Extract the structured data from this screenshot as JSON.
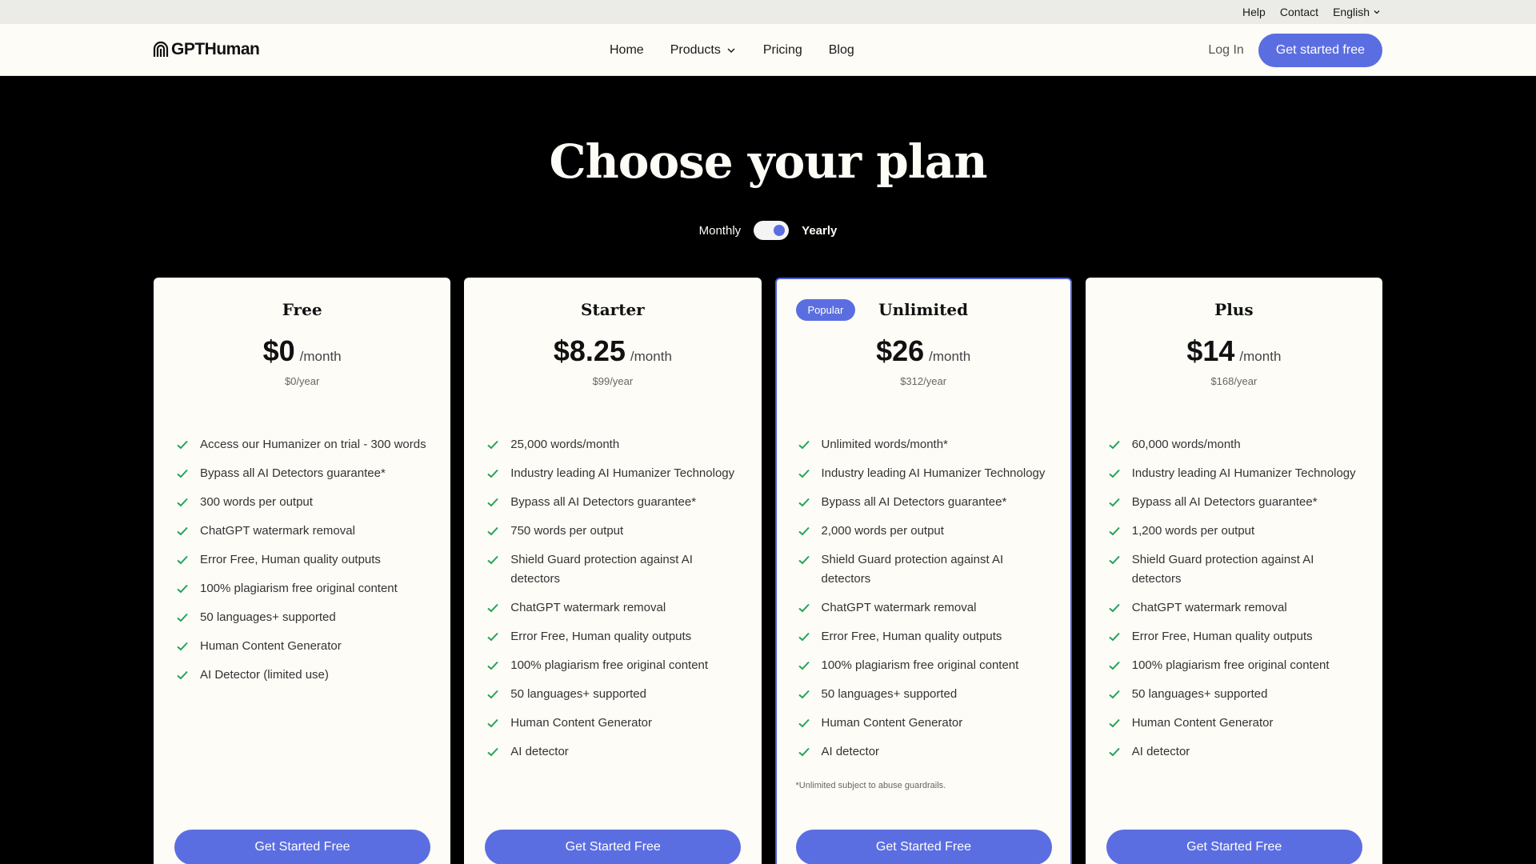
{
  "util_nav": {
    "help": "Help",
    "contact": "Contact",
    "language": "English"
  },
  "brand": {
    "name": "GPTHuman"
  },
  "nav": {
    "home": "Home",
    "products": "Products",
    "pricing": "Pricing",
    "blog": "Blog",
    "login": "Log In",
    "cta": "Get started free"
  },
  "hero": {
    "title": "Choose your plan",
    "toggle_monthly": "Monthly",
    "toggle_yearly": "Yearly",
    "toggle_state": "yearly"
  },
  "colors": {
    "accent": "#5b6ee1",
    "check": "#22a35a",
    "card_bg": "#fdfcf6",
    "page_bg": "#000000"
  },
  "plans": [
    {
      "name": "Free",
      "price": "$0",
      "per": "/month",
      "yearly": "$0/year",
      "button": "Get Started Free",
      "features": [
        "Access our Humanizer on trial - 300 words",
        "Bypass all AI Detectors guarantee*",
        "300 words per output",
        "ChatGPT watermark removal",
        "Error Free, Human quality outputs",
        "100% plagiarism free original content",
        "50 languages+ supported",
        "Human Content Generator",
        "AI Detector (limited use)"
      ]
    },
    {
      "name": "Starter",
      "price": "$8.25",
      "per": "/month",
      "yearly": "$99/year",
      "button": "Get Started Free",
      "features": [
        "25,000 words/month",
        "Industry leading AI Humanizer Technology",
        "Bypass all AI Detectors guarantee*",
        "750 words per output",
        "Shield Guard protection against AI detectors",
        "ChatGPT watermark removal",
        "Error Free, Human quality outputs",
        "100% plagiarism free original content",
        "50 languages+ supported",
        "Human Content Generator",
        "AI detector"
      ]
    },
    {
      "name": "Unlimited",
      "badge": "Popular",
      "price": "$26",
      "per": "/month",
      "yearly": "$312/year",
      "button": "Get Started Free",
      "footnote": "*Unlimited subject to abuse guardrails.",
      "features": [
        "Unlimited words/month*",
        "Industry leading AI Humanizer Technology",
        "Bypass all AI Detectors guarantee*",
        "2,000 words per output",
        "Shield Guard protection against AI detectors",
        "ChatGPT watermark removal",
        "Error Free, Human quality outputs",
        "100% plagiarism free original content",
        "50 languages+ supported",
        "Human Content Generator",
        "AI detector"
      ]
    },
    {
      "name": "Plus",
      "price": "$14",
      "per": "/month",
      "yearly": "$168/year",
      "button": "Get Started Free",
      "features": [
        "60,000 words/month",
        "Industry leading AI Humanizer Technology",
        "Bypass all AI Detectors guarantee*",
        "1,200 words per output",
        "Shield Guard protection against AI detectors",
        "ChatGPT watermark removal",
        "Error Free, Human quality outputs",
        "100% plagiarism free original content",
        "50 languages+ supported",
        "Human Content Generator",
        "AI detector"
      ]
    }
  ]
}
